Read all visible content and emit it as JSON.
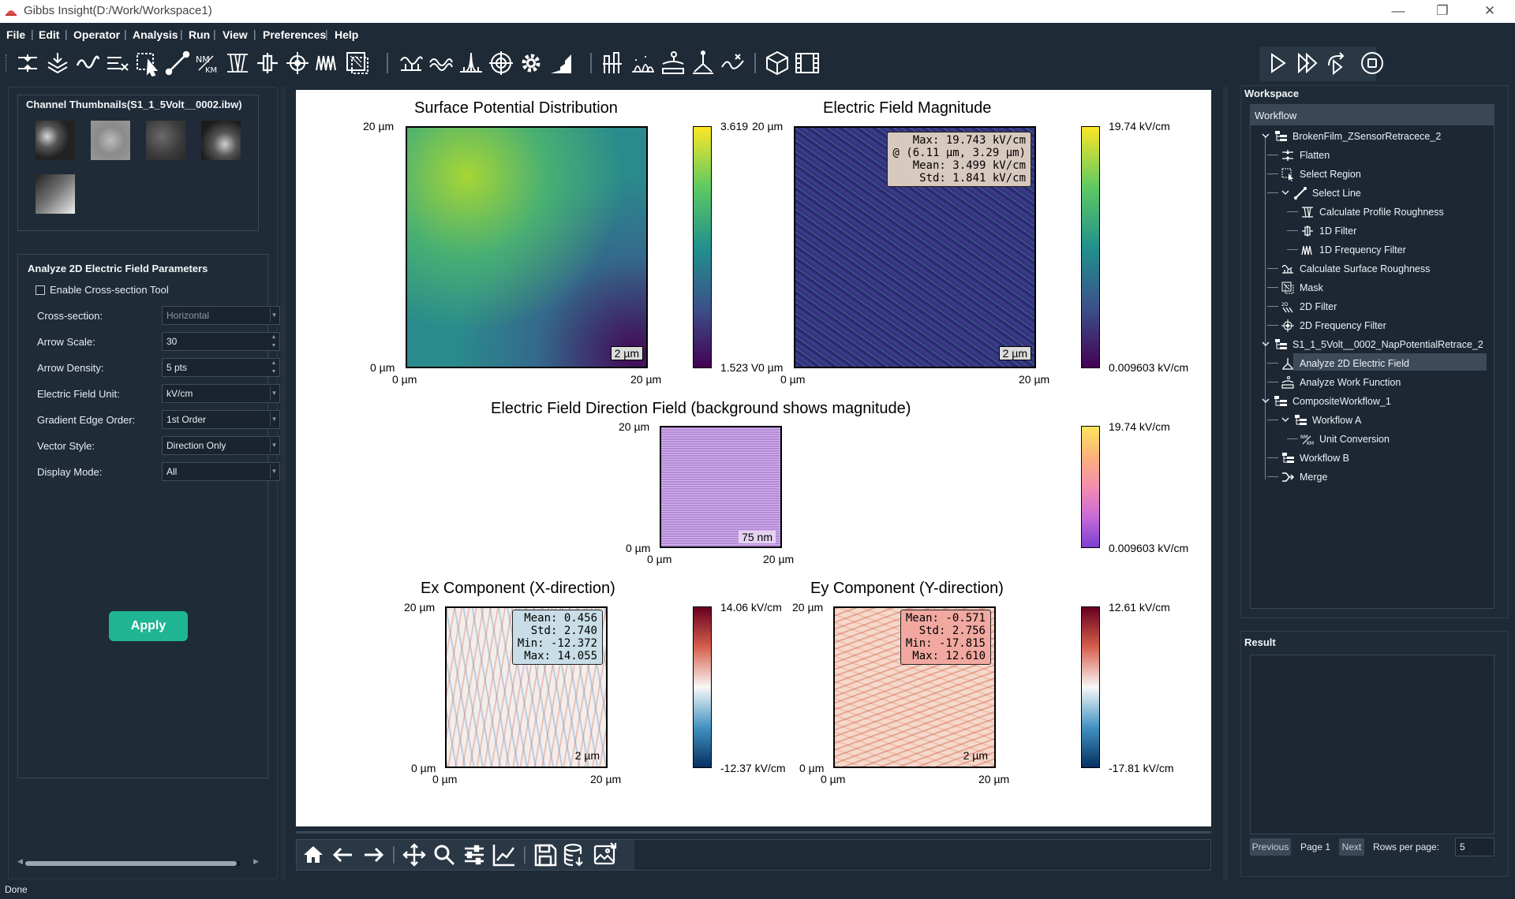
{
  "app": {
    "title": "Gibbs Insight(D:/Work/Workspace1)",
    "status": "Done",
    "menu": [
      "File",
      "Edit",
      "Operator",
      "Analysis",
      "Run",
      "View",
      "Preferences",
      "Help"
    ]
  },
  "thumbnails": {
    "title": "Channel Thumbnails(S1_1_5Volt__0002.ibw)"
  },
  "params": {
    "title": "Analyze 2D Electric Field Parameters",
    "enable_cross_section": "Enable Cross-section Tool",
    "fields": [
      {
        "label": "Cross-section:",
        "value": "Horizontal"
      },
      {
        "label": "Arrow Scale:",
        "value": "30"
      },
      {
        "label": "Arrow Density:",
        "value": "5 pts"
      },
      {
        "label": "Electric Field Unit:",
        "value": "kV/cm"
      },
      {
        "label": "Gradient Edge Order:",
        "value": "1st Order"
      },
      {
        "label": "Vector Style:",
        "value": "Direction Only"
      },
      {
        "label": "Display Mode:",
        "value": "All"
      }
    ],
    "apply": "Apply"
  },
  "plots": {
    "p1": {
      "title": "Surface Potential Distribution",
      "y_top": "20 µm",
      "y_bot": "0 µm",
      "x_left": "0 µm",
      "x_right": "20 µm",
      "scale": "2 µm",
      "cb_max": "3.619",
      "cb_min": "1.523 V"
    },
    "p2": {
      "title": "Electric Field Magnitude",
      "y_top": "20 µm",
      "y_bot": "0 µm",
      "x_left": "0 µm",
      "x_right": "20 µm",
      "scale": "2 µm",
      "cb_max": "19.74 kV/cm",
      "cb_min": "0.009603 kV/cm",
      "stats": [
        "Max: 19.743 kV/cm",
        "@ (6.11 µm, 3.29 µm)",
        "Mean: 3.499 kV/cm",
        "Std: 1.841 kV/cm"
      ]
    },
    "p3": {
      "title": "Electric Field Direction Field (background shows magnitude)",
      "y_top": "20 µm",
      "y_bot": "0 µm",
      "x_left": "0 µm",
      "x_right": "20 µm",
      "scale": "75 nm",
      "cb_max": "19.74 kV/cm",
      "cb_min": "0.009603 kV/cm"
    },
    "p4": {
      "title": "Ex Component (X-direction)",
      "y_top": "20 µm",
      "y_bot": "0 µm",
      "x_left": "0 µm",
      "x_right": "20 µm",
      "scale": "2 µm",
      "cb_max": "14.06 kV/cm",
      "cb_min": "-12.37 kV/cm",
      "stats": [
        "Mean: 0.456",
        "Std: 2.740",
        "Min: -12.372",
        "Max: 14.055"
      ]
    },
    "p5": {
      "title": "Ey Component (Y-direction)",
      "y_top": "20 µm",
      "y_bot": "0 µm",
      "x_left": "0 µm",
      "x_right": "20 µm",
      "scale": "2 µm",
      "cb_max": "12.61 kV/cm",
      "cb_min": "-17.81 kV/cm",
      "stats": [
        "Mean: -0.571",
        "Std: 2.756",
        "Min: -17.815",
        "Max: 12.610"
      ]
    }
  },
  "workspace": {
    "title": "Workspace",
    "header": "Workflow",
    "items": [
      {
        "label": "BrokenFilm_ZSensorRetracece_2",
        "icon": "workflow-icon"
      },
      {
        "label": "Flatten",
        "icon": "flatten-icon"
      },
      {
        "label": "Select Region",
        "icon": "select-region-icon"
      },
      {
        "label": "Select Line",
        "icon": "select-line-icon"
      },
      {
        "label": "Calculate Profile Roughness",
        "icon": "profile-roughness-icon"
      },
      {
        "label": "1D Filter",
        "icon": "filter-1d-icon"
      },
      {
        "label": "1D Frequency Filter",
        "icon": "frequency-filter-1d-icon"
      },
      {
        "label": "Calculate Surface Roughness",
        "icon": "surface-roughness-icon"
      },
      {
        "label": "Mask",
        "icon": "mask-icon"
      },
      {
        "label": "2D Filter",
        "icon": "filter-2d-icon"
      },
      {
        "label": "2D Frequency Filter",
        "icon": "frequency-filter-2d-icon"
      },
      {
        "label": "S1_1_5Volt__0002_NapPotentialRetrace_2",
        "icon": "workflow-icon"
      },
      {
        "label": "Analyze 2D Electric Field",
        "icon": "electric-field-icon"
      },
      {
        "label": "Analyze Work Function",
        "icon": "work-function-icon"
      },
      {
        "label": "CompositeWorkflow_1",
        "icon": "composite-workflow-icon"
      },
      {
        "label": "Workflow A",
        "icon": "workflow-icon"
      },
      {
        "label": "Unit Conversion",
        "icon": "unit-conversion-icon"
      },
      {
        "label": "Workflow B",
        "icon": "workflow-icon"
      },
      {
        "label": "Merge",
        "icon": "merge-icon"
      }
    ]
  },
  "result": {
    "title": "Result",
    "previous": "Previous",
    "page": "Page 1",
    "next": "Next",
    "rows_label": "Rows per page:",
    "rows_value": "5"
  }
}
